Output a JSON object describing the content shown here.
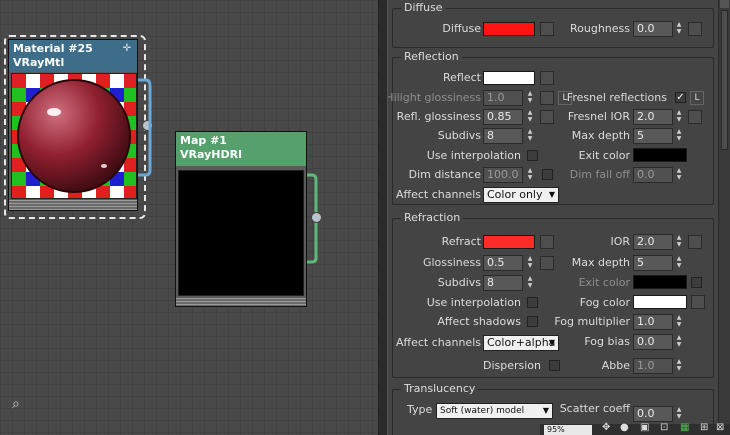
{
  "nodes": {
    "material": {
      "title": "Material #25",
      "type": "VRayMtl",
      "header_color": "#3e6d8a"
    },
    "map": {
      "title": "Map #1",
      "type": "VRayHDRI",
      "header_color": "#56a06e"
    }
  },
  "viewport": {
    "zoom": "95%"
  },
  "diffuse": {
    "title": "Diffuse",
    "diffuse_label": "Diffuse",
    "diffuse_color": "#ff1414",
    "roughness_label": "Roughness",
    "roughness_value": "0.0"
  },
  "reflection": {
    "title": "Reflection",
    "reflect_label": "Reflect",
    "reflect_color": "#ffffff",
    "hilight_label": "Hilight glossiness",
    "hilight_value": "1.0",
    "l_label": "L",
    "fresnel_label": "Fresnel reflections",
    "fresnel_check": "✓",
    "refl_gloss_label": "Refl. glossiness",
    "refl_gloss_value": "0.85",
    "fresnel_ior_label": "Fresnel IOR",
    "fresnel_ior_value": "2.0",
    "subdivs_label": "Subdivs",
    "subdivs_value": "8",
    "max_depth_label": "Max depth",
    "max_depth_value": "5",
    "use_interp_label": "Use interpolation",
    "exit_color_label": "Exit color",
    "exit_color": "#000000",
    "dim_distance_label": "Dim distance",
    "dim_distance_value": "100.0",
    "dim_falloff_label": "Dim fall off",
    "dim_falloff_value": "0.0",
    "affect_channels_label": "Affect channels",
    "affect_channels_value": "Color only"
  },
  "refraction": {
    "title": "Refraction",
    "refract_label": "Refract",
    "refract_color": "#ff2a2a",
    "ior_label": "IOR",
    "ior_value": "2.0",
    "glossiness_label": "Glossiness",
    "glossiness_value": "0.5",
    "max_depth_label": "Max depth",
    "max_depth_value": "5",
    "subdivs_label": "Subdivs",
    "subdivs_value": "8",
    "exit_color_label": "Exit color",
    "exit_color": "#000000",
    "use_interp_label": "Use interpolation",
    "fog_color_label": "Fog color",
    "fog_color": "#ffffff",
    "affect_shadows_label": "Affect shadows",
    "fog_mult_label": "Fog multiplier",
    "fog_mult_value": "1.0",
    "affect_channels_label": "Affect channels",
    "affect_channels_value": "Color+alpha",
    "fog_bias_label": "Fog bias",
    "fog_bias_value": "0.0",
    "dispersion_label": "Dispersion",
    "abbe_label": "Abbe",
    "abbe_value": "1.0"
  },
  "translucency": {
    "title": "Translucency",
    "type_label": "Type",
    "type_value": "Soft (water) model",
    "scatter_label": "Scatter coeff",
    "scatter_value": "0.0"
  }
}
